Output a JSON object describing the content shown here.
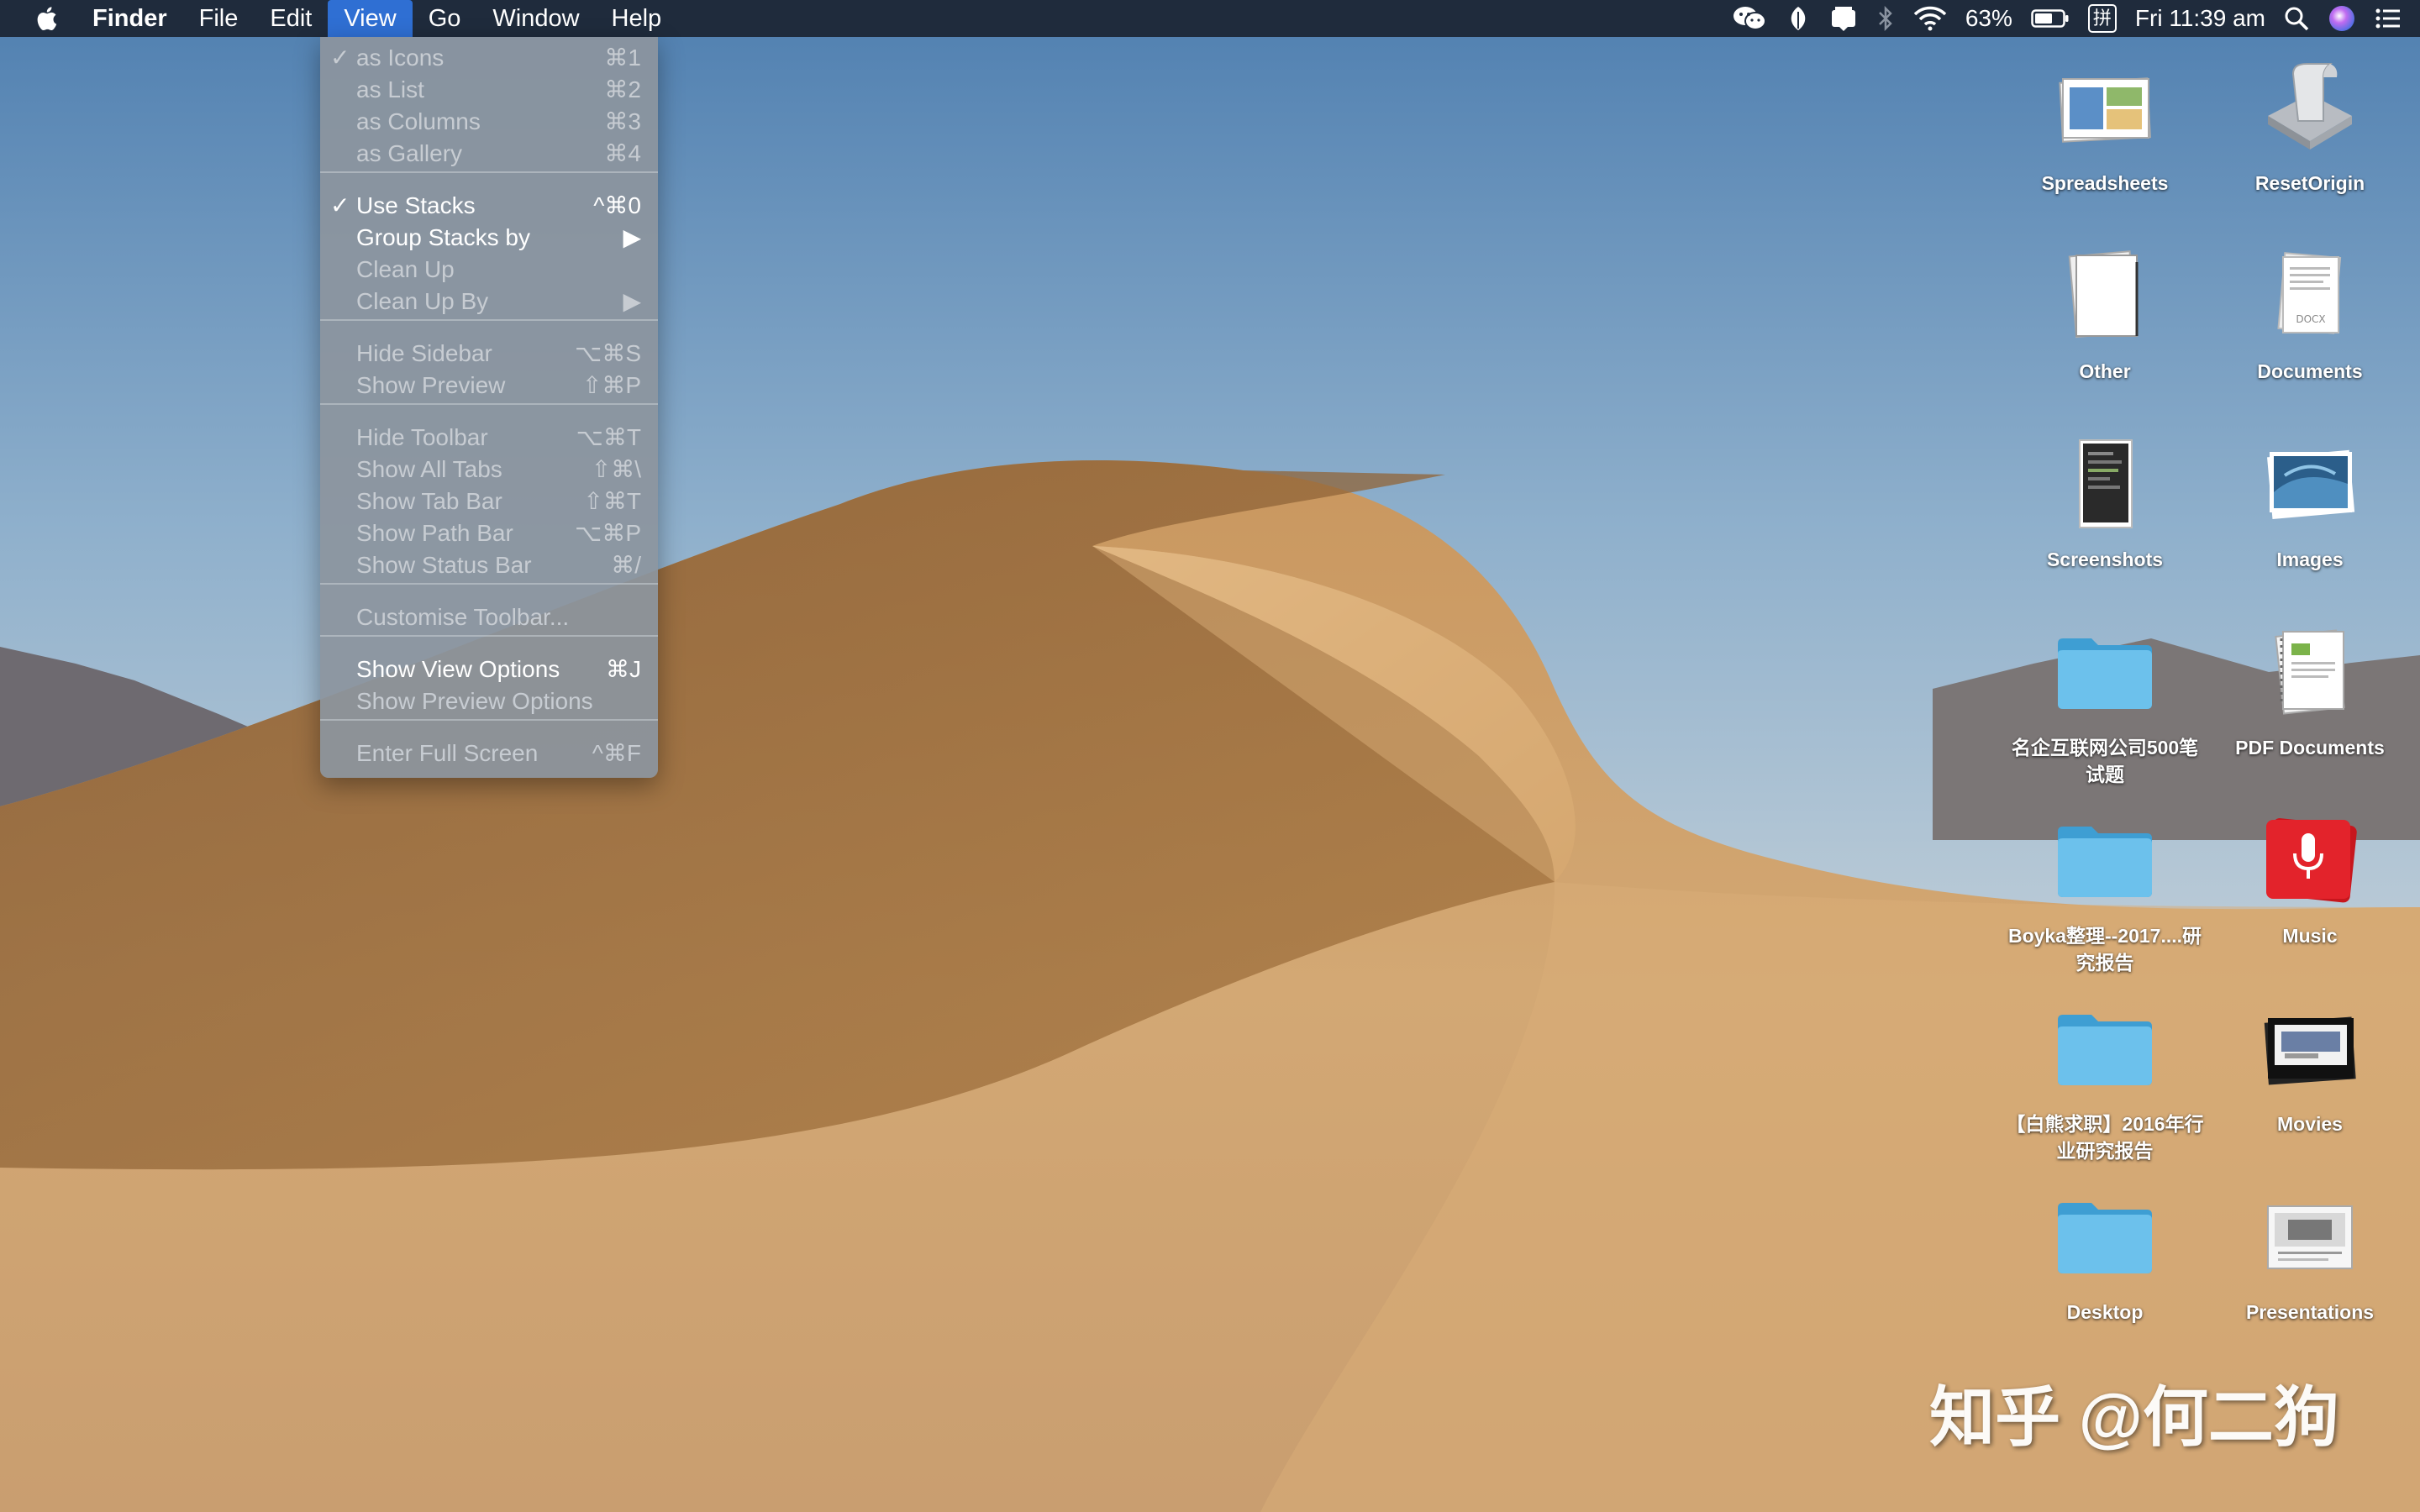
{
  "menubar": {
    "app_name": "Finder",
    "menus": [
      "File",
      "Edit",
      "View",
      "Go",
      "Window",
      "Help"
    ],
    "active_menu": "View",
    "battery": "63%",
    "input_method": "拼",
    "clock": "Fri 11:39 am",
    "accent_color": "#2f6fd3"
  },
  "view_menu": {
    "items": [
      {
        "label": "as Icons",
        "shortcut": "⌘1",
        "checked": true,
        "enabled": false
      },
      {
        "label": "as List",
        "shortcut": "⌘2",
        "enabled": false
      },
      {
        "label": "as Columns",
        "shortcut": "⌘3",
        "enabled": false
      },
      {
        "label": "as Gallery",
        "shortcut": "⌘4",
        "enabled": false
      },
      {
        "label": "Use Stacks",
        "shortcut": "^⌘0",
        "checked": true,
        "enabled": true
      },
      {
        "label": "Group Stacks by",
        "shortcut": "▶",
        "enabled": true
      },
      {
        "label": "Clean Up",
        "shortcut": "",
        "enabled": false
      },
      {
        "label": "Clean Up By",
        "shortcut": "▶",
        "enabled": false
      },
      {
        "label": "Hide Sidebar",
        "shortcut": "⌥⌘S",
        "enabled": false
      },
      {
        "label": "Show Preview",
        "shortcut": "⇧⌘P",
        "enabled": false
      },
      {
        "label": "Hide Toolbar",
        "shortcut": "⌥⌘T",
        "enabled": false
      },
      {
        "label": "Show All Tabs",
        "shortcut": "⇧⌘\\",
        "enabled": false
      },
      {
        "label": "Show Tab Bar",
        "shortcut": "⇧⌘T",
        "enabled": false
      },
      {
        "label": "Show Path Bar",
        "shortcut": "⌥⌘P",
        "enabled": false
      },
      {
        "label": "Show Status Bar",
        "shortcut": "⌘/",
        "enabled": false
      },
      {
        "label": "Customise Toolbar...",
        "shortcut": "",
        "enabled": false
      },
      {
        "label": "Show View Options",
        "shortcut": "⌘J",
        "enabled": true
      },
      {
        "label": "Show Preview Options",
        "shortcut": "",
        "enabled": false
      },
      {
        "label": "Enter Full Screen",
        "shortcut": "^⌘F",
        "enabled": false
      }
    ]
  },
  "desktop_icons": [
    {
      "label": "Spreadsheets",
      "icon": "stack-spreadsheets-icon"
    },
    {
      "label": "ResetOrigin",
      "icon": "script-app-icon"
    },
    {
      "label": "Other",
      "icon": "stack-other-icon"
    },
    {
      "label": "Documents",
      "icon": "stack-documents-icon"
    },
    {
      "label": "Screenshots",
      "icon": "stack-screenshots-icon"
    },
    {
      "label": "Images",
      "icon": "stack-images-icon"
    },
    {
      "label": "名企互联网公司500笔试题",
      "icon": "folder-icon"
    },
    {
      "label": "PDF Documents",
      "icon": "stack-pdf-icon"
    },
    {
      "label": "Boyka整理--2017....研究报告",
      "icon": "folder-icon"
    },
    {
      "label": "Music",
      "icon": "stack-music-icon"
    },
    {
      "label": "【白熊求职】2016年行业研究报告",
      "icon": "folder-icon"
    },
    {
      "label": "Movies",
      "icon": "stack-movies-icon"
    },
    {
      "label": "Desktop",
      "icon": "folder-icon"
    },
    {
      "label": "Presentations",
      "icon": "stack-presentations-icon"
    }
  ],
  "watermark": "知乎 @何二狗"
}
